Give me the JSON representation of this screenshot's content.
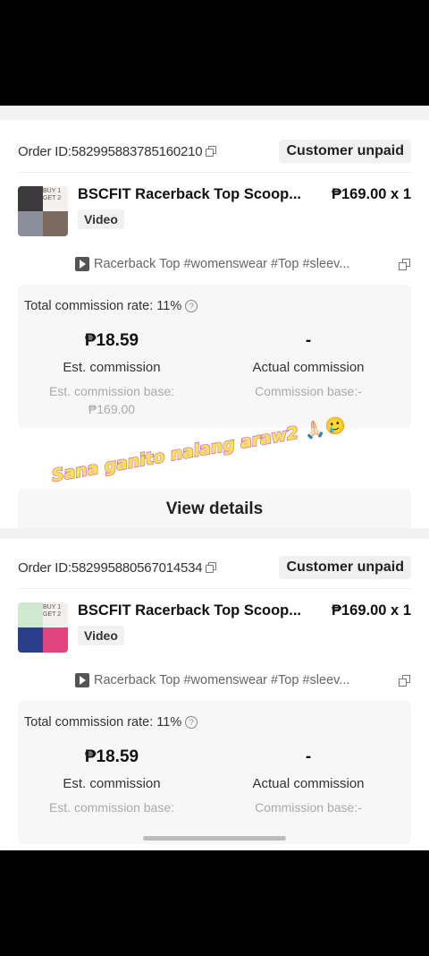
{
  "orders": [
    {
      "order_id_label": "Order ID:582995883785160210",
      "status": "Customer unpaid",
      "product_title": "BSCFIT Racerback Top Scoop...",
      "price_qty": "₱169.00 x 1",
      "badge": "Video",
      "thumb_text": "BUY 1\nGET 2",
      "video_caption": "Racerback Top #womenswear #Top #sleev...",
      "commission_rate": "Total commission rate: 11%",
      "est_commission_amount": "₱18.59",
      "est_commission_label": "Est. commission",
      "est_base_label": "Est. commission base:",
      "est_base_value": "₱169.00",
      "actual_commission_amount": "-",
      "actual_commission_label": "Actual commission",
      "actual_base_label": "Commission base:-",
      "details_button": "View details"
    },
    {
      "order_id_label": "Order ID:582995880567014534",
      "status": "Customer unpaid",
      "product_title": "BSCFIT Racerback Top Scoop...",
      "price_qty": "₱169.00 x 1",
      "badge": "Video",
      "thumb_text": "BUY 1\nGET 2",
      "video_caption": "Racerback Top #womenswear #Top #sleev...",
      "commission_rate": "Total commission rate: 11%",
      "est_commission_amount": "₱18.59",
      "est_commission_label": "Est. commission",
      "est_base_label": "Est. commission base:",
      "actual_commission_amount": "-",
      "actual_commission_label": "Actual commission",
      "actual_base_label": "Commission base:-"
    }
  ],
  "overlay_caption": "Sana ganito nalang araw2",
  "overlay_emoji": "🙏🏻🥲"
}
